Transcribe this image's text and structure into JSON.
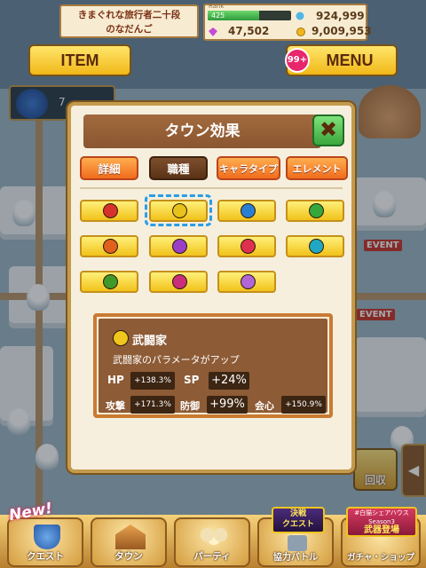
{
  "header": {
    "player_name_line1": "きまぐれな旅行者二十段",
    "player_name_line2": "のなだんご",
    "rank_label": "Rank",
    "rank_value": "425",
    "rank_progress": 0.62,
    "stamina": "924,999",
    "gems": "47,502",
    "gold": "9,009,953"
  },
  "buttons": {
    "item": "ITEM",
    "menu": "MENU",
    "menu_badge": "99+"
  },
  "modal": {
    "title": "タウン効果",
    "close_icon": "close-x-icon",
    "tabs": [
      {
        "label": "詳細",
        "active": false
      },
      {
        "label": "職種",
        "active": true
      },
      {
        "label": "キャラタイプ",
        "active": false
      },
      {
        "label": "エレメント",
        "active": false
      }
    ],
    "job_icons": [
      {
        "name": "sword-icon",
        "color": "#d7332a"
      },
      {
        "name": "fist-icon",
        "color": "#e8c21c"
      },
      {
        "name": "lance-icon",
        "color": "#2a7fd3"
      },
      {
        "name": "axe-icon",
        "color": "#35a83d"
      },
      {
        "name": "bow-icon",
        "color": "#e0611c"
      },
      {
        "name": "staff-icon",
        "color": "#9a3fc6"
      },
      {
        "name": "hammer-icon",
        "color": "#e0304f"
      },
      {
        "name": "gun-icon",
        "color": "#22a7c2"
      },
      {
        "name": "claw-icon",
        "color": "#3f9a2a"
      },
      {
        "name": "whip-icon",
        "color": "#c92e7a"
      },
      {
        "name": "book-icon",
        "color": "#b066d4"
      }
    ],
    "selected_index": 1,
    "info": {
      "title": "武闘家",
      "description": "武闘家のパラメータがアップ",
      "hp_label": "HP",
      "hp_value": "+138.3%",
      "sp_label": "SP",
      "sp_value": "+24%",
      "atk_label": "攻撃",
      "atk_value": "+171.3%",
      "def_label": "防御",
      "def_value": "+99%",
      "crit_label": "会心",
      "crit_value": "+150.9%"
    }
  },
  "background": {
    "event_labels": [
      "EVENT",
      "EVENT"
    ],
    "collect_label": "回収",
    "level_badge": "7"
  },
  "nav": {
    "new_tag": "New!",
    "items": [
      {
        "label": "クエスト",
        "icon": "quest-shield-icon"
      },
      {
        "label": "タウン",
        "icon": "town-icon"
      },
      {
        "label": "パーティ",
        "icon": "party-icon"
      },
      {
        "label": "協力バトル",
        "icon": "coop-battle-icon"
      },
      {
        "label": "ガチャ・ショップ",
        "icon": "gacha-shop-icon"
      }
    ],
    "coop_banner_line1": "決戦",
    "coop_banner_line2": "クエスト",
    "gacha_banner_line1": "#白猫シェアハウス",
    "gacha_banner_line2": "Season3",
    "gacha_banner_line3": "武器登場"
  }
}
